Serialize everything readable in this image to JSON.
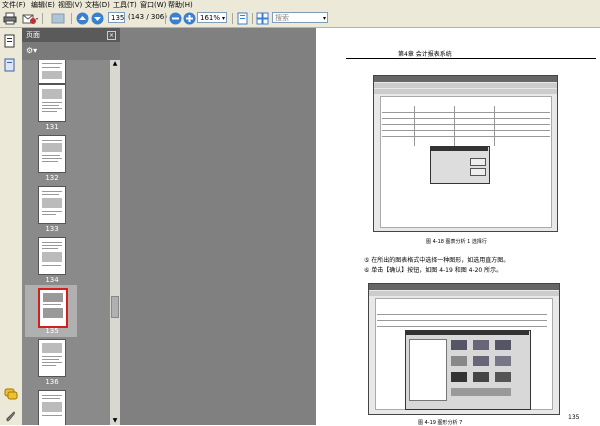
{
  "menubar": {
    "items": [
      "文件(F)",
      "编辑(E)",
      "视图(V)",
      "文档(D)",
      "工具(T)",
      "窗口(W)",
      "帮助(H)"
    ]
  },
  "toolbar": {
    "page_number": "135",
    "page_count": "(143 / 306)",
    "zoom": "161%",
    "search_placeholder": "搜索"
  },
  "icons": {
    "print": "print-icon",
    "email": "email-icon",
    "hand": "hand-tool-icon",
    "up": "page-up-icon",
    "down": "page-down-icon",
    "zoom_out": "zoom-out-icon",
    "zoom_in": "zoom-in-icon",
    "fit": "fit-page-icon",
    "pages": "pages-panel-icon",
    "attach": "attachment-icon",
    "comments": "comments-icon"
  },
  "panel": {
    "title": "页面",
    "thumbnails": [
      {
        "label": "",
        "selected": false
      },
      {
        "label": "131",
        "selected": false
      },
      {
        "label": "132",
        "selected": false
      },
      {
        "label": "133",
        "selected": false
      },
      {
        "label": "134",
        "selected": false
      },
      {
        "label": "135",
        "selected": true
      },
      {
        "label": "136",
        "selected": false
      },
      {
        "label": "",
        "selected": false
      }
    ]
  },
  "document": {
    "header": "第4章  会计报表系统",
    "fig1_caption": "图 4-18  图表分析 1  选择行",
    "step5": "⑤ 在所出的图表格式中选择一种图形，如选用直方图。",
    "step6": "⑥ 单击【确认】按钮，如图 4-19 和图 4-20 所示。",
    "fig2_caption": "图 4-19  图形分析 7",
    "page_number": "135"
  },
  "colors": {
    "chrome": "#ece9d8",
    "panel_bg": "#888888",
    "selection": "#d02020",
    "doc_bg": "#808080"
  }
}
